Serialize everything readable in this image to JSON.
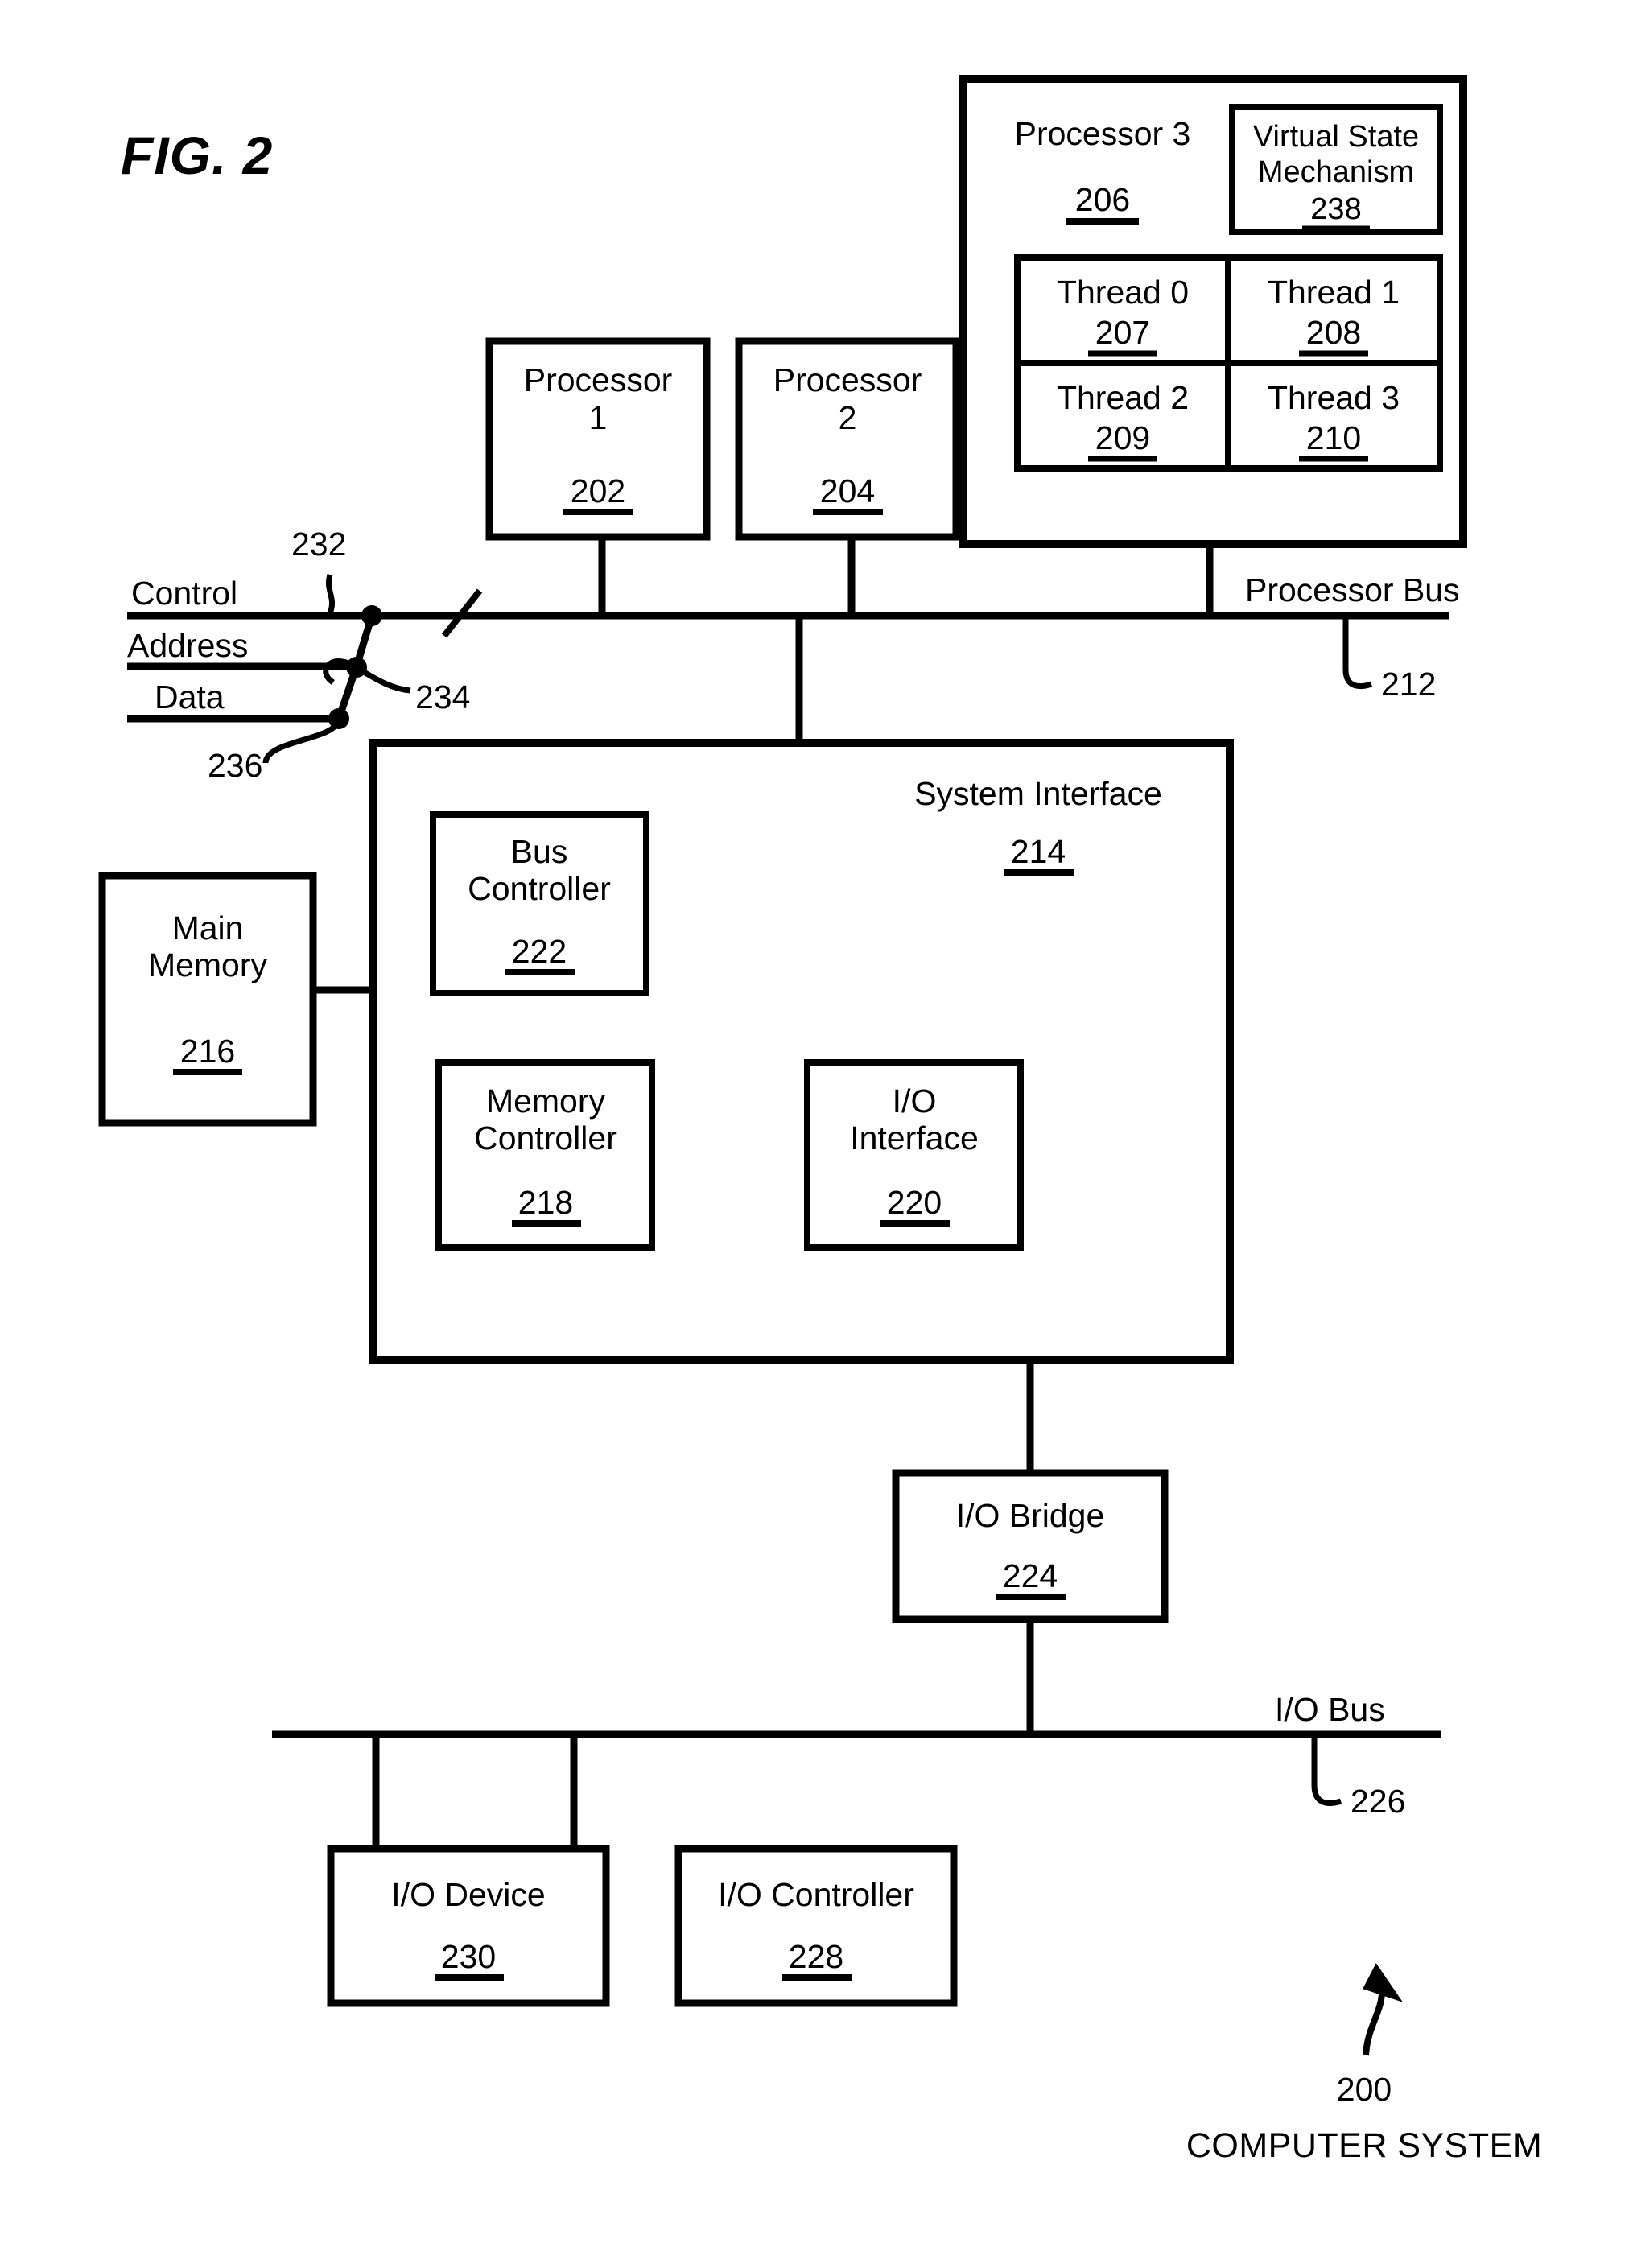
{
  "figure": {
    "title": "FIG. 2",
    "caption_number": "200",
    "caption_label": "COMPUTER SYSTEM"
  },
  "blocks": {
    "processor1": {
      "name": "Processor",
      "index": "1",
      "ref": "202"
    },
    "processor2": {
      "name": "Processor",
      "index": "2",
      "ref": "204"
    },
    "processor3": {
      "name": "Processor 3",
      "ref": "206"
    },
    "virtual_state_mechanism": {
      "line1": "Virtual State",
      "line2": "Mechanism",
      "ref": "238"
    },
    "threads": [
      {
        "name": "Thread 0",
        "ref": "207"
      },
      {
        "name": "Thread 1",
        "ref": "208"
      },
      {
        "name": "Thread 2",
        "ref": "209"
      },
      {
        "name": "Thread 3",
        "ref": "210"
      }
    ],
    "system_interface": {
      "name": "System Interface",
      "ref": "214"
    },
    "bus_controller": {
      "line1": "Bus",
      "line2": "Controller",
      "ref": "222"
    },
    "memory_controller": {
      "line1": "Memory",
      "line2": "Controller",
      "ref": "218"
    },
    "io_interface": {
      "line1": "I/O",
      "line2": "Interface",
      "ref": "220"
    },
    "main_memory": {
      "line1": "Main",
      "line2": "Memory",
      "ref": "216"
    },
    "io_bridge": {
      "name": "I/O Bridge",
      "ref": "224"
    },
    "io_device": {
      "name": "I/O Device",
      "ref": "230"
    },
    "io_controller": {
      "name": "I/O Controller",
      "ref": "228"
    }
  },
  "buses": {
    "processor_bus": {
      "label": "Processor Bus",
      "ref": "212"
    },
    "io_bus": {
      "label": "I/O Bus",
      "ref": "226"
    },
    "signals": [
      {
        "label": "Control",
        "ref": "232"
      },
      {
        "label": "Address",
        "ref": "234"
      },
      {
        "label": "Data",
        "ref": "236"
      }
    ]
  },
  "style": {
    "stroke": "#000000",
    "background": "#ffffff"
  }
}
